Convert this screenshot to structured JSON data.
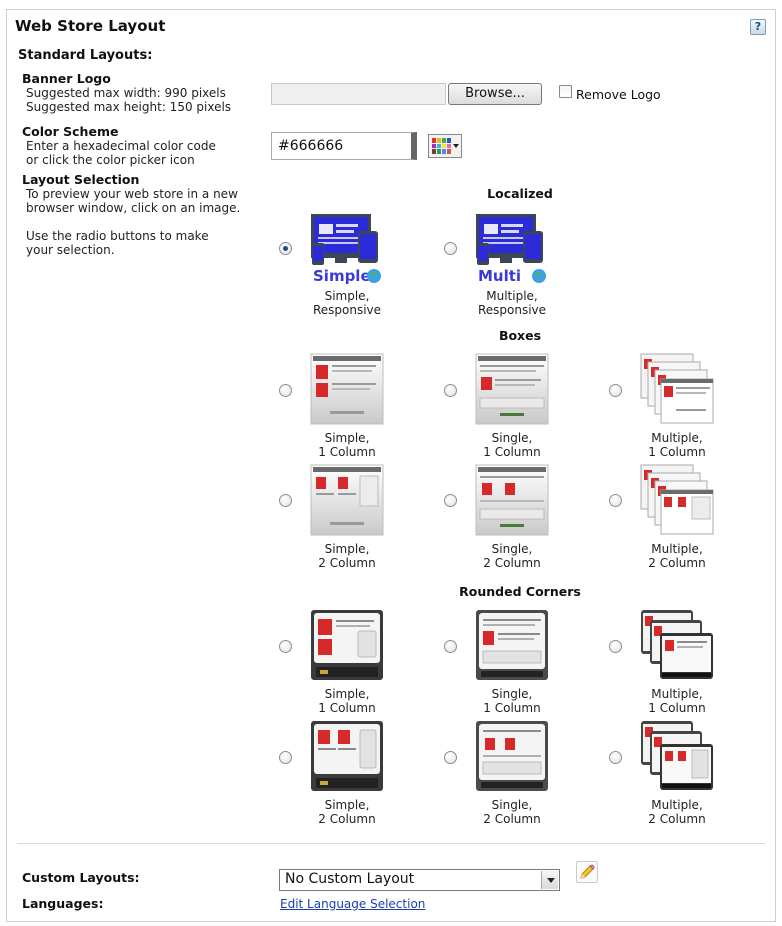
{
  "header": {
    "title": "Web Store Layout",
    "help_icon_label": "?"
  },
  "standard": {
    "title": "Standard Layouts:",
    "banner": {
      "label": "Banner Logo",
      "hint1": "Suggested max width: 990 pixels",
      "hint2": "Suggested max height: 150 pixels",
      "file_value": "",
      "browse_label": "Browse...",
      "remove_label": "Remove Logo",
      "remove_checked": false
    },
    "color": {
      "label": "Color Scheme",
      "hint1": "Enter a hexadecimal color code",
      "hint2": "or click the color picker icon",
      "value": "#666666",
      "swatch": "#666666"
    },
    "layout": {
      "label": "Layout Selection",
      "hint1": "To preview your web store in a new",
      "hint2": "browser window, click on an image.",
      "hint3": "Use the radio buttons to make",
      "hint4": "your selection."
    }
  },
  "groups": {
    "localized": {
      "heading": "Localized",
      "options": [
        {
          "line1": "Simple,",
          "line2": "Responsive",
          "badge": "Simple",
          "selected": true
        },
        {
          "line1": "Multiple,",
          "line2": "Responsive",
          "badge": "Multi",
          "selected": false
        }
      ]
    },
    "boxes": {
      "heading": "Boxes",
      "options": [
        {
          "line1": "Simple,",
          "line2": "1 Column",
          "selected": false
        },
        {
          "line1": "Single,",
          "line2": "1 Column",
          "selected": false
        },
        {
          "line1": "Multiple,",
          "line2": "1 Column",
          "selected": false
        },
        {
          "line1": "Simple,",
          "line2": "2 Column",
          "selected": false
        },
        {
          "line1": "Single,",
          "line2": "2 Column",
          "selected": false
        },
        {
          "line1": "Multiple,",
          "line2": "2 Column",
          "selected": false
        }
      ]
    },
    "rounded": {
      "heading": "Rounded Corners",
      "options": [
        {
          "line1": "Simple,",
          "line2": "1 Column",
          "selected": false
        },
        {
          "line1": "Single,",
          "line2": "1 Column",
          "selected": false
        },
        {
          "line1": "Multiple,",
          "line2": "1 Column",
          "selected": false
        },
        {
          "line1": "Simple,",
          "line2": "2 Column",
          "selected": false
        },
        {
          "line1": "Single,",
          "line2": "2 Column",
          "selected": false
        },
        {
          "line1": "Multiple,",
          "line2": "2 Column",
          "selected": false
        }
      ]
    }
  },
  "custom": {
    "label": "Custom Layouts:",
    "selected": "No Custom Layout",
    "languages_label": "Languages:",
    "languages_link": "Edit Language Selection"
  },
  "colors": {
    "monitor_blue": "#2b2bd9",
    "device_frame": "#3d4654",
    "badge_text": "#3a3ad8",
    "link": "#1a3fb4",
    "radio_dot": "#1b4d8a",
    "thumb_red": "#d62a2a",
    "thumb_dark": "#3a3a3a"
  }
}
